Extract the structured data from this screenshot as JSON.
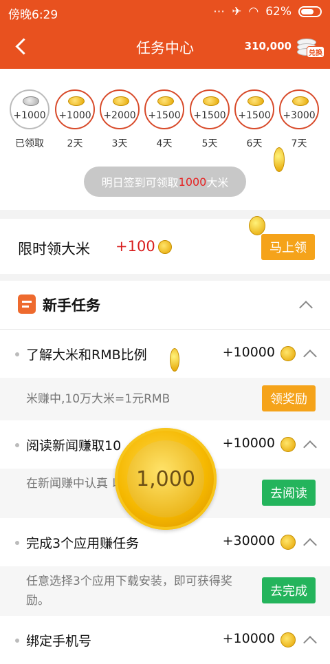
{
  "statusbar": {
    "time": "傍晚6:29",
    "battery": "62%"
  },
  "header": {
    "title": "任务中心",
    "balance": "310,000",
    "exchange_label": "兑换"
  },
  "checkin": {
    "days": [
      {
        "amount": "+1000",
        "label": "已领取",
        "claimed": true
      },
      {
        "amount": "+1000",
        "label": "2天",
        "claimed": false
      },
      {
        "amount": "+2000",
        "label": "3天",
        "claimed": false
      },
      {
        "amount": "+1500",
        "label": "4天",
        "claimed": false
      },
      {
        "amount": "+1500",
        "label": "5天",
        "claimed": false
      },
      {
        "amount": "+1500",
        "label": "6天",
        "claimed": false
      },
      {
        "amount": "+3000",
        "label": "7天",
        "claimed": false
      }
    ],
    "tip_prefix": "明日签到可领取",
    "tip_amount": "1000",
    "tip_suffix": "大米"
  },
  "limited": {
    "label": "限时领大米",
    "bonus": "+100",
    "button": "马上领"
  },
  "newbie": {
    "title": "新手任务"
  },
  "tasks": [
    {
      "name": "了解大米和RMB比例",
      "reward": "+10000",
      "desc": "米赚中,10万大米=1元RMB",
      "button": "领奖励",
      "button_color": "#f5a31a"
    },
    {
      "name": "阅读新闻赚取10",
      "reward": "+10000",
      "desc": "在新闻赚中认真                     以赚钱。",
      "button": "去阅读",
      "button_color": "#24b45c"
    },
    {
      "name": "完成3个应用赚任务",
      "reward": "+30000",
      "desc": "任意选择3个应用下载安装，即可获得奖励。",
      "button": "去完成",
      "button_color": "#24b45c"
    },
    {
      "name": "绑定手机号",
      "reward": "+10000"
    }
  ],
  "coin_popup": {
    "value": "1,000"
  },
  "colors": {
    "brand": "#e8511f",
    "accent_red": "#d81e1e",
    "orange_button": "#f5a31a",
    "green_button": "#24b45c"
  }
}
